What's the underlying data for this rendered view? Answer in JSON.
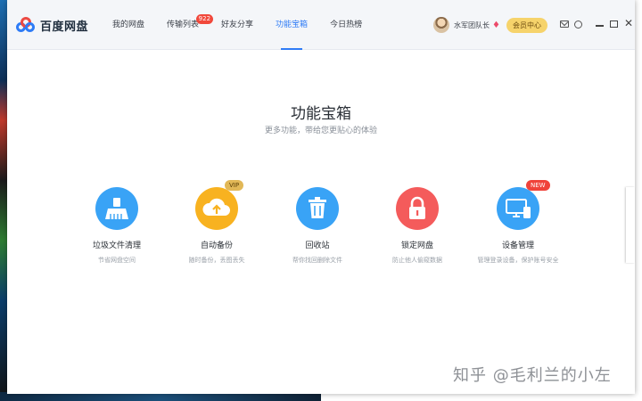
{
  "app": {
    "name": "百度网盘"
  },
  "nav": {
    "items": [
      {
        "label": "我的网盘",
        "active": false
      },
      {
        "label": "传输列表",
        "active": false,
        "badge": "922"
      },
      {
        "label": "好友分享",
        "active": false
      },
      {
        "label": "功能宝箱",
        "active": true
      },
      {
        "label": "今日热榜",
        "active": false
      }
    ]
  },
  "user": {
    "name": "水军团队长",
    "member_button": "会员中心"
  },
  "page": {
    "title": "功能宝箱",
    "subtitle": "更多功能，带给您更贴心的体验"
  },
  "tools": [
    {
      "name": "垃圾文件清理",
      "desc": "节省网盘空间",
      "icon": "broom-icon",
      "color": "#39a3f6"
    },
    {
      "name": "自动备份",
      "desc": "随时备份，丢图丢失",
      "icon": "cloud-upload-icon",
      "color": "#f8b220",
      "tag": "VIP"
    },
    {
      "name": "回收站",
      "desc": "帮你找回删除文件",
      "icon": "trash-icon",
      "color": "#39a3f6"
    },
    {
      "name": "锁定网盘",
      "desc": "防止他人偷窥数据",
      "icon": "lock-icon",
      "color": "#f45b5b"
    },
    {
      "name": "设备管理",
      "desc": "管理登录设备，保护账号安全",
      "icon": "devices-icon",
      "color": "#39a3f6",
      "tag": "NEW"
    }
  ],
  "watermark": "知乎 @毛利兰的小左"
}
